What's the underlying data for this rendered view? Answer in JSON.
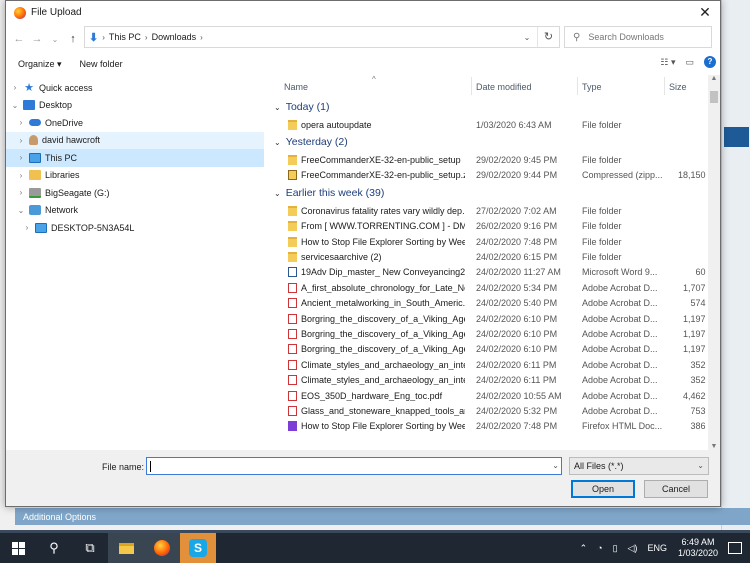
{
  "window": {
    "title": "File Upload",
    "close": "✕"
  },
  "address": {
    "segments": [
      "This PC",
      "Downloads"
    ]
  },
  "search": {
    "placeholder": "Search Downloads"
  },
  "toolbar": {
    "organize": "Organize ▾",
    "new_folder": "New folder"
  },
  "nav_tree": [
    {
      "label": "Quick access",
      "icon": "star-icon",
      "indent": 0,
      "chevron": "›",
      "state": ""
    },
    {
      "label": "Desktop",
      "icon": "desktop-icon",
      "indent": 0,
      "chevron": "⌄",
      "state": ""
    },
    {
      "label": "OneDrive",
      "icon": "cloud-icon",
      "indent": 1,
      "chevron": "›",
      "state": ""
    },
    {
      "label": "david hawcroft",
      "icon": "user-icon",
      "indent": 1,
      "chevron": "›",
      "state": "hover"
    },
    {
      "label": "This PC",
      "icon": "pc-icon",
      "indent": 1,
      "chevron": "›",
      "state": "selected"
    },
    {
      "label": "Libraries",
      "icon": "library-icon",
      "indent": 1,
      "chevron": "›",
      "state": ""
    },
    {
      "label": "BigSeagate (G:)",
      "icon": "drive-icon",
      "indent": 1,
      "chevron": "›",
      "state": ""
    },
    {
      "label": "Network",
      "icon": "network-icon",
      "indent": 1,
      "chevron": "⌄",
      "state": ""
    },
    {
      "label": "DESKTOP-5N3A54L",
      "icon": "pc-icon",
      "indent": 2,
      "chevron": "›",
      "state": ""
    }
  ],
  "columns": {
    "name": "Name",
    "date": "Date modified",
    "type": "Type",
    "size": "Size"
  },
  "groups": [
    {
      "label": "Today (1)",
      "files": [
        {
          "name": "opera autoupdate",
          "date": "1/03/2020 6:43 AM",
          "type": "File folder",
          "size": "",
          "kind": "folder"
        }
      ]
    },
    {
      "label": "Yesterday (2)",
      "files": [
        {
          "name": "FreeCommanderXE-32-en-public_setup",
          "date": "29/02/2020 9:45 PM",
          "type": "File folder",
          "size": "",
          "kind": "folder"
        },
        {
          "name": "FreeCommanderXE-32-en-public_setup.z...",
          "date": "29/02/2020 9:44 PM",
          "type": "Compressed (zipp...",
          "size": "18,150 K",
          "kind": "zip"
        }
      ]
    },
    {
      "label": "Earlier this week (39)",
      "files": [
        {
          "name": "Coronavirus fatality rates vary wildly dep...",
          "date": "27/02/2020 7:02 AM",
          "type": "File folder",
          "size": "",
          "kind": "folder"
        },
        {
          "name": "From [ WWW.TORRENTING.COM ] - DMT...",
          "date": "26/02/2020 9:16 PM",
          "type": "File folder",
          "size": "",
          "kind": "folder"
        },
        {
          "name": "How to Stop File Explorer Sorting by Wee...",
          "date": "24/02/2020 7:48 PM",
          "type": "File folder",
          "size": "",
          "kind": "folder"
        },
        {
          "name": "servicesaarchive (2)",
          "date": "24/02/2020 6:15 PM",
          "type": "File folder",
          "size": "",
          "kind": "folder"
        },
        {
          "name": "19Adv Dip_master_ New Conveyancing2...",
          "date": "24/02/2020 11:27 AM",
          "type": "Microsoft Word 9...",
          "size": "60 K",
          "kind": "word"
        },
        {
          "name": "A_first_absolute_chronology_for_Late_Ne...",
          "date": "24/02/2020 5:34 PM",
          "type": "Adobe Acrobat D...",
          "size": "1,707 K",
          "kind": "pdf"
        },
        {
          "name": "Ancient_metalworking_in_South_Americ...",
          "date": "24/02/2020 5:40 PM",
          "type": "Adobe Acrobat D...",
          "size": "574 K",
          "kind": "pdf"
        },
        {
          "name": "Borgring_the_discovery_of_a_Viking_Age...",
          "date": "24/02/2020 6:10 PM",
          "type": "Adobe Acrobat D...",
          "size": "1,197 K",
          "kind": "pdf"
        },
        {
          "name": "Borgring_the_discovery_of_a_Viking_Age...",
          "date": "24/02/2020 6:10 PM",
          "type": "Adobe Acrobat D...",
          "size": "1,197 K",
          "kind": "pdf"
        },
        {
          "name": "Borgring_the_discovery_of_a_Viking_Age...",
          "date": "24/02/2020 6:10 PM",
          "type": "Adobe Acrobat D...",
          "size": "1,197 K",
          "kind": "pdf"
        },
        {
          "name": "Climate_styles_and_archaeology_an_inte...",
          "date": "24/02/2020 6:11 PM",
          "type": "Adobe Acrobat D...",
          "size": "352 K",
          "kind": "pdf"
        },
        {
          "name": "Climate_styles_and_archaeology_an_inte...",
          "date": "24/02/2020 6:11 PM",
          "type": "Adobe Acrobat D...",
          "size": "352 K",
          "kind": "pdf"
        },
        {
          "name": "EOS_350D_hardware_Eng_toc.pdf",
          "date": "24/02/2020 10:55 AM",
          "type": "Adobe Acrobat D...",
          "size": "4,462 K",
          "kind": "pdf"
        },
        {
          "name": "Glass_and_stoneware_knapped_tools_am...",
          "date": "24/02/2020 5:32 PM",
          "type": "Adobe Acrobat D...",
          "size": "753 K",
          "kind": "pdf"
        },
        {
          "name": "How to Stop File Explorer Sorting by Wee...",
          "date": "24/02/2020 7:48 PM",
          "type": "Firefox HTML Doc...",
          "size": "386 K",
          "kind": "html"
        }
      ]
    }
  ],
  "bottom": {
    "file_name_label": "File name:",
    "file_name_value": "",
    "filter": "All Files (*.*)",
    "open": "Open",
    "cancel": "Cancel"
  },
  "background": {
    "additional_options": "Additional Options"
  },
  "taskbar": {
    "lang": "ENG",
    "time": "6:49 AM",
    "date": "1/03/2020"
  }
}
